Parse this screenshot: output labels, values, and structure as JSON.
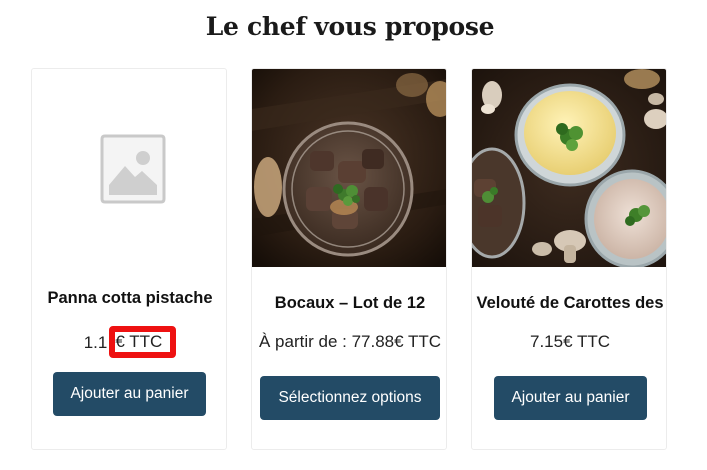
{
  "section": {
    "title": "Le chef vous propose"
  },
  "products": [
    {
      "name": "Panna cotta pistache",
      "price_prefix": "1.1",
      "price_highlight": "€ TTC",
      "button_label": "Ajouter au panier",
      "image": "placeholder-image-icon"
    },
    {
      "name": "Bocaux – Lot de 12",
      "price": "À partir de : 77.88€ TTC",
      "button_label": "Sélectionnez options",
      "image": "jar-of-meat-photo"
    },
    {
      "name": "Velouté de Carottes des",
      "price": "7.15€ TTC",
      "button_label": "Ajouter au panier",
      "image": "bowls-of-food-photo"
    }
  ],
  "colors": {
    "button_bg": "#234b66",
    "button_text": "#ffffff",
    "highlight_border": "#ee1111",
    "card_border": "#ececec"
  }
}
